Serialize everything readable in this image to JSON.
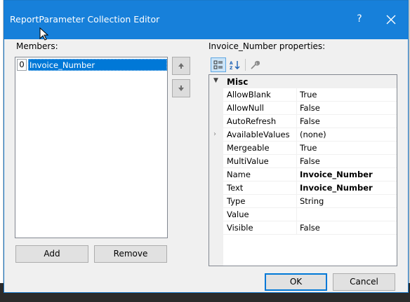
{
  "dialog": {
    "title": "ReportParameter Collection Editor",
    "help_glyph": "?",
    "close_glyph": "✕"
  },
  "members": {
    "label": "Members:",
    "items": [
      {
        "index": "0",
        "name": "Invoice_Number"
      }
    ],
    "add_label": "Add",
    "remove_label": "Remove"
  },
  "properties": {
    "label": "Invoice_Number properties:",
    "category": "Misc",
    "rows": [
      {
        "name": "AllowBlank",
        "value": "True",
        "bold": false,
        "expandable": false
      },
      {
        "name": "AllowNull",
        "value": "False",
        "bold": false,
        "expandable": false
      },
      {
        "name": "AutoRefresh",
        "value": "False",
        "bold": false,
        "expandable": false
      },
      {
        "name": "AvailableValues",
        "value": "(none)",
        "bold": false,
        "expandable": true
      },
      {
        "name": "Mergeable",
        "value": "True",
        "bold": false,
        "expandable": false
      },
      {
        "name": "MultiValue",
        "value": "False",
        "bold": false,
        "expandable": false
      },
      {
        "name": "Name",
        "value": "Invoice_Number",
        "bold": true,
        "expandable": false
      },
      {
        "name": "Text",
        "value": "Invoice_Number",
        "bold": true,
        "expandable": false
      },
      {
        "name": "Type",
        "value": "String",
        "bold": false,
        "expandable": false
      },
      {
        "name": "Value",
        "value": "",
        "bold": false,
        "expandable": false
      },
      {
        "name": "Visible",
        "value": "False",
        "bold": false,
        "expandable": false
      }
    ]
  },
  "footer": {
    "ok_label": "OK",
    "cancel_label": "Cancel"
  },
  "colors": {
    "titlebar": "#1780da",
    "selection": "#0078d7"
  }
}
